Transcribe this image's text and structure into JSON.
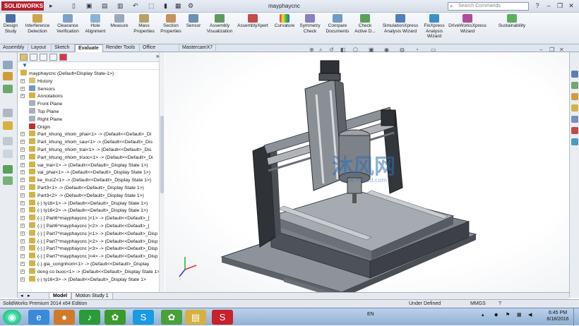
{
  "app": {
    "logo": "SOLIDWORKS",
    "doc_title": "mayphaycnc",
    "search_placeholder": "Search Commands"
  },
  "ribbon": [
    {
      "id": "design-study",
      "label": "Design Study"
    },
    {
      "id": "interference-detection",
      "label": "Interference Detection"
    },
    {
      "id": "clearance-verification",
      "label": "Clearance Verification"
    },
    {
      "id": "hole-alignment",
      "label": "Hole Alignment"
    },
    {
      "id": "measure",
      "label": "Measure"
    },
    {
      "id": "mass-properties",
      "label": "Mass Properties"
    },
    {
      "id": "section-properties",
      "label": "Section Properties"
    },
    {
      "id": "sensor",
      "label": "Sensor"
    },
    {
      "id": "assembly-visualization",
      "label": "Assembly Visualization"
    },
    {
      "id": "assemblyxpert",
      "label": "AssemblyXpert"
    },
    {
      "id": "curvature",
      "label": "Curvature"
    },
    {
      "id": "symmetry-check",
      "label": "Symmetry Check"
    },
    {
      "id": "compare-documents",
      "label": "Compare Documents"
    },
    {
      "id": "check-active-doc",
      "label": "Check Active D..."
    },
    {
      "id": "simulationxpress",
      "label": "SimulationXpress Analysis Wizard"
    },
    {
      "id": "floxpress",
      "label": "FloXpress Analysis Wizard"
    },
    {
      "id": "driveworksxpress",
      "label": "DriveWorksXpress Wizard"
    },
    {
      "id": "sustainability",
      "label": "Sustainability"
    }
  ],
  "tabs": [
    "Assembly",
    "Layout",
    "Sketch",
    "Evaluate",
    "Render Tools",
    "Office Products",
    "MastercamX7"
  ],
  "tree": {
    "root": "mayphaycnc  (Default<Display State-1>)",
    "items": [
      "History",
      "Sensors",
      "Annotations",
      "Front Plane",
      "Top Plane",
      "Right Plane",
      "Origin",
      "Part_khung_nhom_phai<1> -> (Default<<Default>_Di",
      "Part_khung_nhom_sau<1> -> (Default<<Default>_Dis",
      "Part_khung_nhom_trai<1> -> (Default<<Default>_Dis",
      "Part_khung_nhom_truoc<1> -> (Default<<Default>_Di",
      "vai_trai<1> -> (Default<<Default>_Display State 1>)",
      "vai_phai<1> -> (Default<<Default>_Display State 1>)",
      "ke_trucZ<1> -> (Default<<Default>_Display State 1>)",
      "Part3<1> -> (Default<<Default>_Display State 1>)",
      "Part3<2> -> (Default<<Default>_Display State 1>)",
      "(-) ty16<1> -> (Default<<Default>_Display State 1>)",
      "(-) ty16<2> -> (Default<<Default>_Display State 1>)",
      "(-) [ Part6^mayphaycnc ]<1> -> (Default<<Default>_[",
      "(-) [ Part6^mayphaycnc ]<2> -> (Default<<Default>_[",
      "(-) [ Part7^mayphaycnc ]<1> -> (Default<<Default>_Disp",
      "(-) [ Part7^mayphaycnc ]<2> -> (Default<<Default>_Disp",
      "(-) [ Part7^mayphaycnc ]<3> -> (Default<<Default>_Disp",
      "(-) [ Part7^mayphaycnc ]<4> -> (Default<<Default>_Disp",
      "(-) gia_congnhom<1> -> (Default<<Default>_Display",
      "dong co buoc<1> -> (Default<<Default>_Display State 1>",
      "(-) ty16<3> -> (Default<<Default>_Display State 1>"
    ]
  },
  "bottom_tabs": [
    "Model",
    "Motion Study 1"
  ],
  "status": {
    "edition": "SolidWorks Premium 2014 x64 Edition",
    "state": "Under Defined",
    "units": "MMGS"
  },
  "taskbar": {
    "lang": "EN",
    "time": "6:45 PM",
    "date": "8/18/2016"
  },
  "watermark": {
    "main": "沐风网",
    "sub": "www.mfcad.com"
  },
  "colors": {
    "accent": "#b3202c",
    "taskbar": "#8fb0d3"
  }
}
